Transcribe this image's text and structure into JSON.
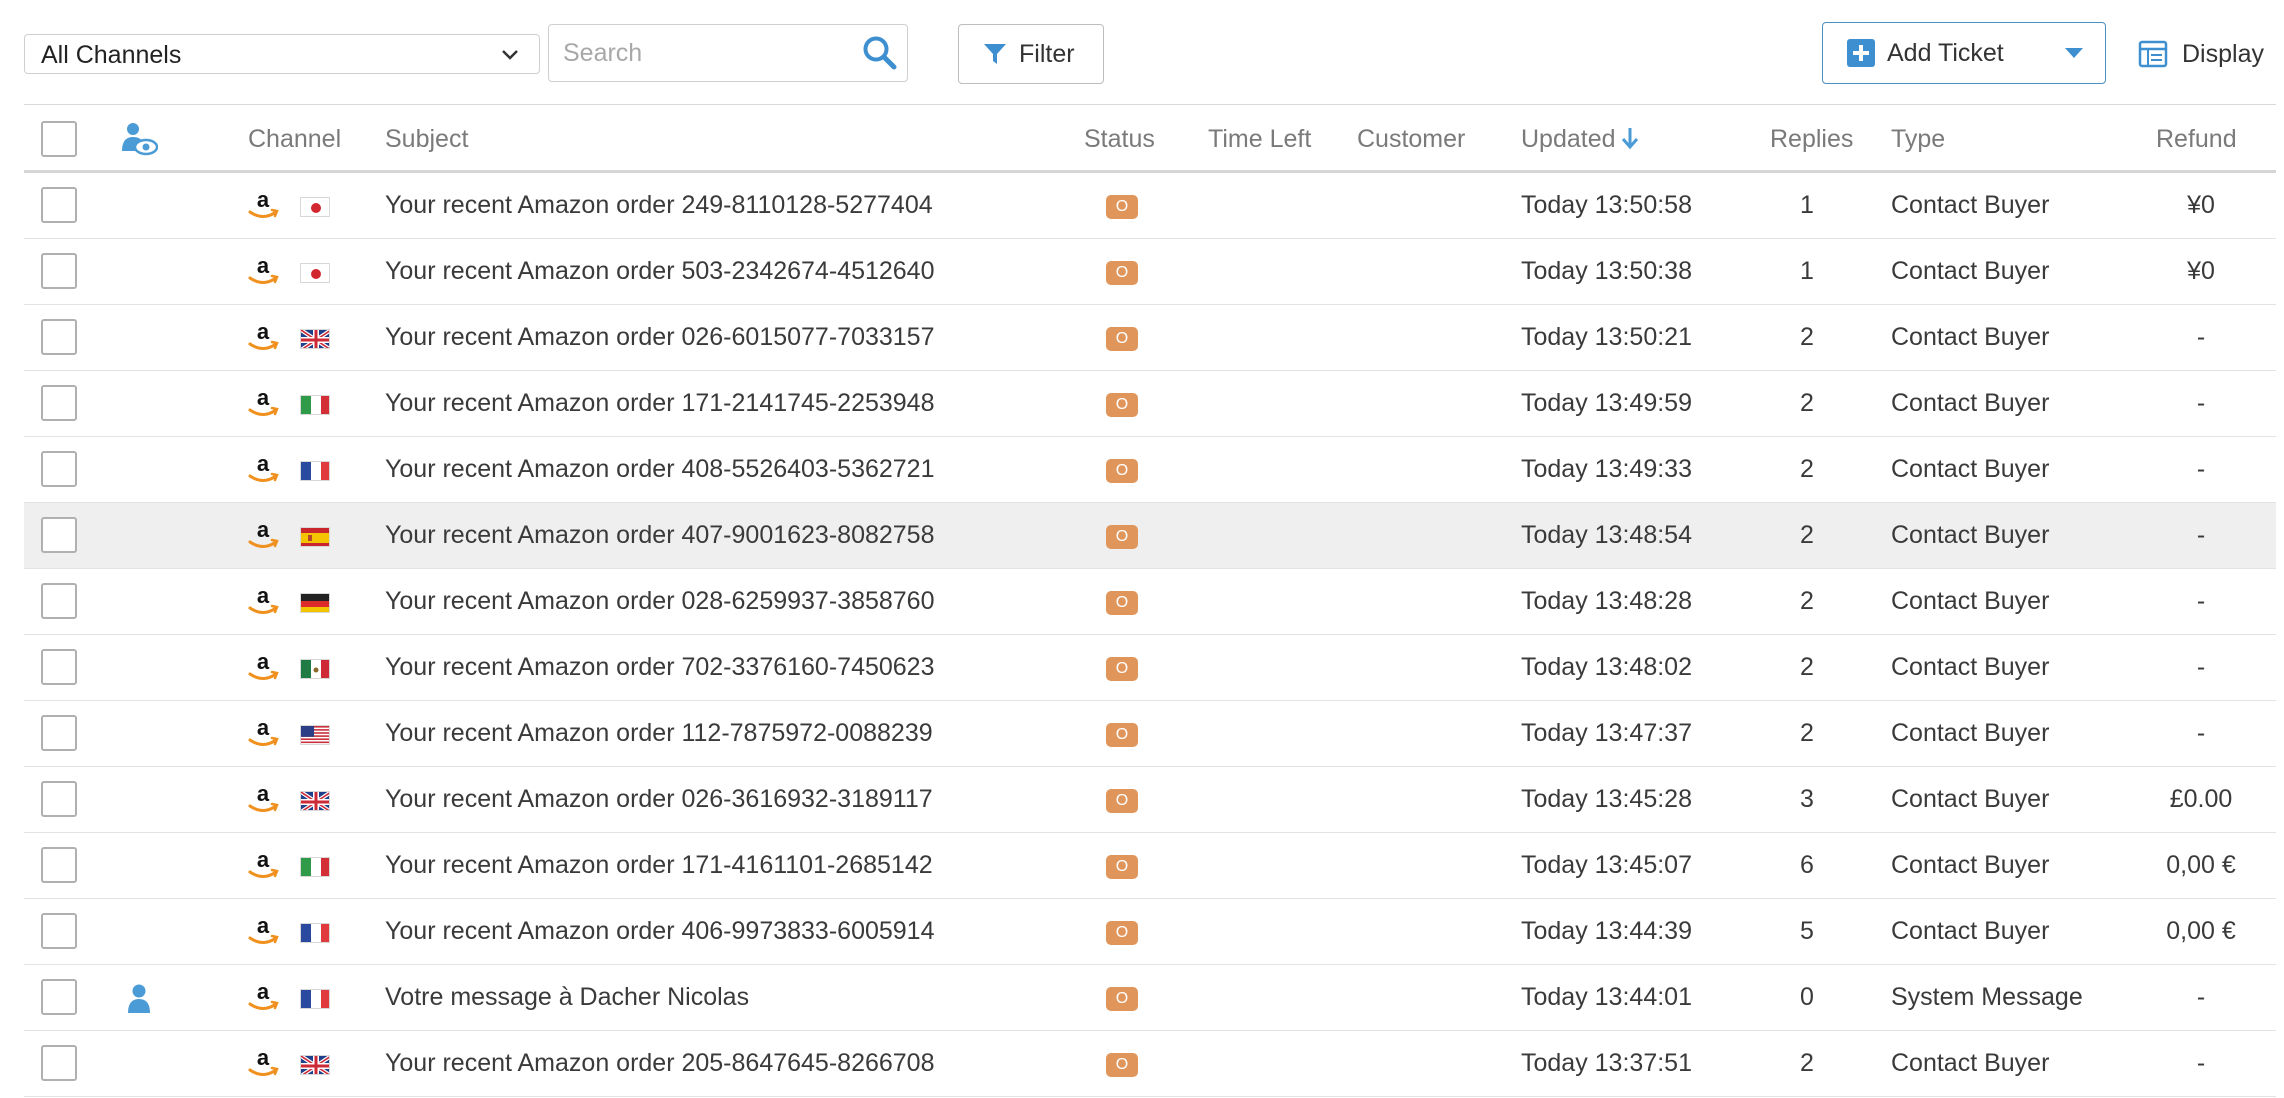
{
  "toolbar": {
    "channel_select_value": "All Channels",
    "search_placeholder": "Search",
    "filter_label": "Filter",
    "add_ticket_label": "Add Ticket",
    "display_label": "Display"
  },
  "table": {
    "headers": {
      "channel": "Channel",
      "subject": "Subject",
      "status": "Status",
      "time_left": "Time Left",
      "customer": "Customer",
      "updated": "Updated",
      "replies": "Replies",
      "type": "Type",
      "refund": "Refund"
    },
    "rows": [
      {
        "channel_icon": "amazon-icon",
        "flag": "jp",
        "subject": "Your recent Amazon order 249-8110128-5277404",
        "status": "O",
        "time_left": "",
        "customer": "",
        "updated": "Today 13:50:58",
        "replies": "1",
        "type": "Contact Buyer",
        "refund": "¥0",
        "assignee_icon": ""
      },
      {
        "channel_icon": "amazon-icon",
        "flag": "jp",
        "subject": "Your recent Amazon order 503-2342674-4512640",
        "status": "O",
        "time_left": "",
        "customer": "",
        "updated": "Today 13:50:38",
        "replies": "1",
        "type": "Contact Buyer",
        "refund": "¥0",
        "assignee_icon": ""
      },
      {
        "channel_icon": "amazon-icon",
        "flag": "gb",
        "subject": "Your recent Amazon order 026-6015077-7033157",
        "status": "O",
        "time_left": "",
        "customer": "",
        "updated": "Today 13:50:21",
        "replies": "2",
        "type": "Contact Buyer",
        "refund": "-",
        "assignee_icon": ""
      },
      {
        "channel_icon": "amazon-icon",
        "flag": "it",
        "subject": "Your recent Amazon order 171-2141745-2253948",
        "status": "O",
        "time_left": "",
        "customer": "",
        "updated": "Today 13:49:59",
        "replies": "2",
        "type": "Contact Buyer",
        "refund": "-",
        "assignee_icon": ""
      },
      {
        "channel_icon": "amazon-icon",
        "flag": "fr",
        "subject": "Your recent Amazon order 408-5526403-5362721",
        "status": "O",
        "time_left": "",
        "customer": "",
        "updated": "Today 13:49:33",
        "replies": "2",
        "type": "Contact Buyer",
        "refund": "-",
        "assignee_icon": ""
      },
      {
        "channel_icon": "amazon-icon",
        "flag": "es",
        "subject": "Your recent Amazon order 407-9001623-8082758",
        "status": "O",
        "time_left": "",
        "customer": "",
        "updated": "Today 13:48:54",
        "replies": "2",
        "type": "Contact Buyer",
        "refund": "-",
        "assignee_icon": ""
      },
      {
        "channel_icon": "amazon-icon",
        "flag": "de",
        "subject": "Your recent Amazon order 028-6259937-3858760",
        "status": "O",
        "time_left": "",
        "customer": "",
        "updated": "Today 13:48:28",
        "replies": "2",
        "type": "Contact Buyer",
        "refund": "-",
        "assignee_icon": ""
      },
      {
        "channel_icon": "amazon-icon",
        "flag": "mx",
        "subject": "Your recent Amazon order 702-3376160-7450623",
        "status": "O",
        "time_left": "",
        "customer": "",
        "updated": "Today 13:48:02",
        "replies": "2",
        "type": "Contact Buyer",
        "refund": "-",
        "assignee_icon": ""
      },
      {
        "channel_icon": "amazon-icon",
        "flag": "us",
        "subject": "Your recent Amazon order 112-7875972-0088239",
        "status": "O",
        "time_left": "",
        "customer": "",
        "updated": "Today 13:47:37",
        "replies": "2",
        "type": "Contact Buyer",
        "refund": "-",
        "assignee_icon": ""
      },
      {
        "channel_icon": "amazon-icon",
        "flag": "gb",
        "subject": "Your recent Amazon order 026-3616932-3189117",
        "status": "O",
        "time_left": "",
        "customer": "",
        "updated": "Today 13:45:28",
        "replies": "3",
        "type": "Contact Buyer",
        "refund": "£0.00",
        "assignee_icon": ""
      },
      {
        "channel_icon": "amazon-icon",
        "flag": "it",
        "subject": "Your recent Amazon order 171-4161101-2685142",
        "status": "O",
        "time_left": "",
        "customer": "",
        "updated": "Today 13:45:07",
        "replies": "6",
        "type": "Contact Buyer",
        "refund": "0,00 €",
        "assignee_icon": ""
      },
      {
        "channel_icon": "amazon-icon",
        "flag": "fr",
        "subject": "Your recent Amazon order 406-9973833-6005914",
        "status": "O",
        "time_left": "",
        "customer": "",
        "updated": "Today 13:44:39",
        "replies": "5",
        "type": "Contact Buyer",
        "refund": "0,00 €",
        "assignee_icon": ""
      },
      {
        "channel_icon": "amazon-icon",
        "flag": "fr",
        "subject": "Votre message à Dacher Nicolas",
        "status": "O",
        "time_left": "",
        "customer": "",
        "updated": "Today 13:44:01",
        "replies": "0",
        "type": "System Message",
        "refund": "-",
        "assignee_icon": "person-icon"
      },
      {
        "channel_icon": "amazon-icon",
        "flag": "gb",
        "subject": "Your recent Amazon order 205-8647645-8266708",
        "status": "O",
        "time_left": "",
        "customer": "",
        "updated": "Today 13:37:51",
        "replies": "2",
        "type": "Contact Buyer",
        "refund": "-",
        "assignee_icon": ""
      }
    ],
    "highlighted_row": 5
  },
  "colors": {
    "accent_blue": "#3d8fd0",
    "status_orange": "#e0955a",
    "amazon_orange": "#f0901e",
    "row_highlight": "#efefef"
  }
}
